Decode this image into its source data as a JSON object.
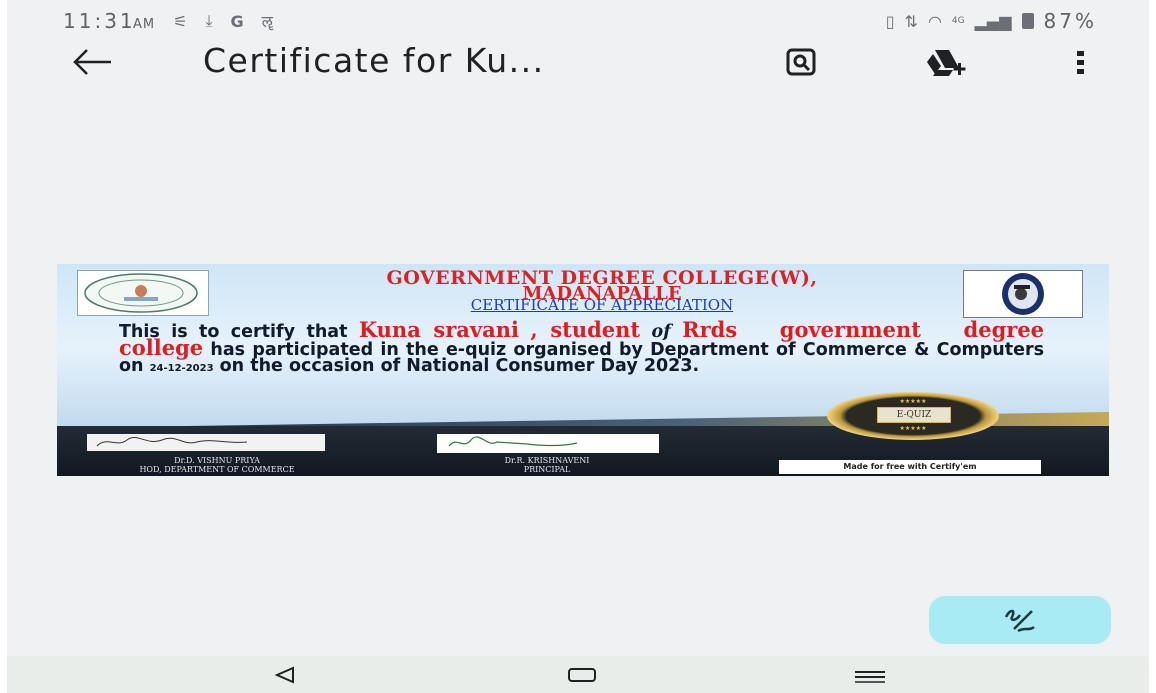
{
  "status_bar": {
    "time": "11:31",
    "ampm": "AM",
    "left_icons": [
      "notification-icon",
      "download-icon",
      "google-icon",
      "vpn-icon"
    ],
    "right_icons": [
      "vibrate-icon",
      "data-arrows-icon",
      "wifi-icon",
      "volte-icon",
      "signal-icon",
      "battery-icon"
    ],
    "battery": "87%"
  },
  "app_bar": {
    "title": "Certificate for Ku...",
    "actions": [
      "lens-icon",
      "add-to-drive-icon",
      "more-options-icon"
    ]
  },
  "certificate": {
    "college_line1": "GOVERNMENT DEGREE COLLEGE(W),",
    "college_line2": "MADANAPALLE",
    "heading": "CERTIFICATE OF APPRECIATION",
    "body_intro": "This is to certify that",
    "student_name": "Kuna sravani",
    "body_student": ", student",
    "body_of": "of",
    "student_college": "Rrds government degree college",
    "body_has": "has",
    "body_main": "participated in the e-quiz organised by Department of Commerce & Computers on",
    "date": "24-12-2023",
    "body_end": "on the occasion of National Consumer Day 2023.",
    "badge": "E-QUIZ",
    "badge_stars": "★★★★★",
    "signer1_name": "Dr.D. VISHNU PRIYA",
    "signer1_title": "HOD, DEPARTMENT OF COMMERCE",
    "signer2_name": "Dr.R. KRISHNAVENI",
    "signer2_title": "PRINCIPAL",
    "made_with": "Made for free with Certify'em"
  },
  "fab": {
    "icon": "edit-sign-icon"
  },
  "nav_bar": {
    "icons": [
      "nav-back-icon",
      "nav-home-icon",
      "nav-recents-icon"
    ]
  },
  "colors": {
    "background": "#f0f1f3",
    "fab": "#a9ebf4",
    "certificate_red": "#e02020",
    "certificate_blue": "#1f35d6",
    "nav_bar": "#e8edea"
  }
}
